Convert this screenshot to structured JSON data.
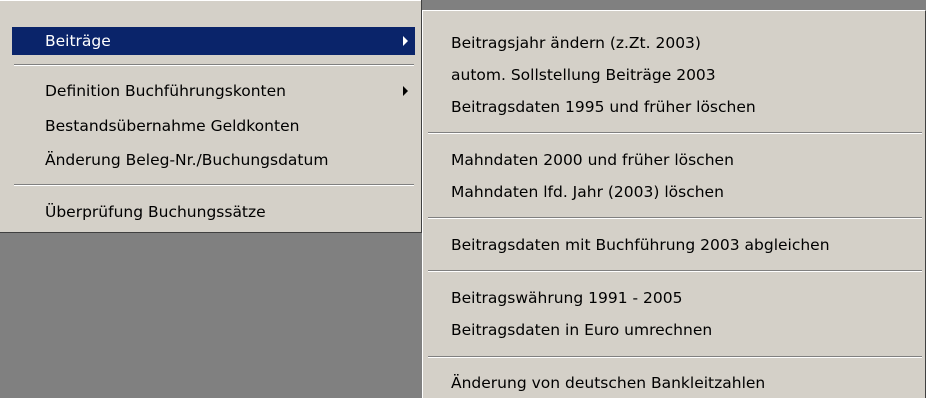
{
  "main_menu": {
    "items": [
      {
        "label": "Beiträge"
      },
      {
        "label": "Definition Buchführungskonten"
      },
      {
        "label": "Bestandsübernahme Geldkonten"
      },
      {
        "label": "Änderung Beleg-Nr./Buchungsdatum"
      },
      {
        "label": "Überprüfung Buchungssätze"
      }
    ]
  },
  "sub_menu": {
    "items": [
      {
        "label": "Beitragsjahr ändern (z.Zt. 2003)"
      },
      {
        "label": "autom. Sollstellung Beiträge 2003"
      },
      {
        "label": "Beitragsdaten 1995 und früher löschen"
      },
      {
        "label": "Mahndaten 2000 und früher löschen"
      },
      {
        "label": "Mahndaten lfd. Jahr (2003) löschen"
      },
      {
        "label": "Beitragsdaten mit Buchführung 2003 abgleichen"
      },
      {
        "label": "Beitragswährung 1991 - 2005"
      },
      {
        "label": "Beitragsdaten in Euro umrechnen"
      },
      {
        "label": "Änderung von deutschen Bankleitzahlen"
      }
    ]
  },
  "colors": {
    "menu_background": "#d4d0c8",
    "highlight": "#0a246a",
    "highlight_text": "#ffffff",
    "desktop": "#808080"
  }
}
